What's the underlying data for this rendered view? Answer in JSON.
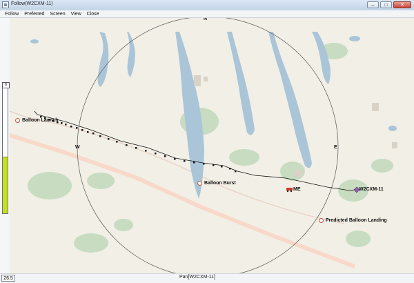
{
  "window": {
    "title": "Follow(W2CXM-11)",
    "minimize": "–",
    "maximize": "□",
    "close": "✕"
  },
  "menu": [
    "Follow",
    "Preferred",
    "Screen",
    "View",
    "Close"
  ],
  "map": {
    "compass": {
      "north": "N",
      "west": "W",
      "east": "E"
    },
    "markers": {
      "launch": "Balloon Launch",
      "burst": "Balloon Burst",
      "landing": "Predicted Balloon Landing",
      "me": "ME",
      "station": "W2CXM-11"
    }
  },
  "side_meter": {
    "top_label": "8",
    "fill_fraction": 0.43,
    "fill_color": "#c7e01e"
  },
  "status": {
    "zoom": "26.5",
    "pan": "Pan[W2CXM-11]"
  }
}
